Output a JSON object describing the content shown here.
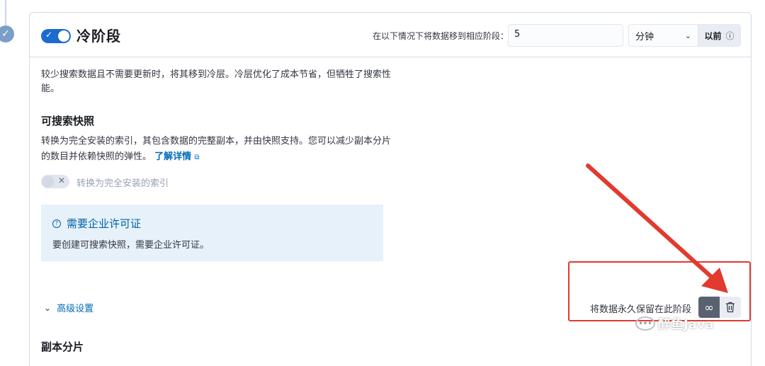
{
  "phase": {
    "title": "冷阶段",
    "enabled": true,
    "move_label": "在以下情况下将数据移到相应阶段：",
    "age_value": "5",
    "unit_selected": "分钟",
    "unit_suffix": "以前",
    "description": "较少搜索数据且不需要更新时，将其移到冷层。冷层优化了成本节省，但牺牲了搜索性能。"
  },
  "searchable_snapshot": {
    "title": "可搜索快照",
    "description": "转换为完全安装的索引，其包含数据的完整副本，并由快照支持。您可以减少副本分片的数目并依赖快照的弹性。",
    "learn_more": "了解详情",
    "toggle_label": "转换为完全安装的索引",
    "toggle_enabled": false
  },
  "callout": {
    "title": "需要企业许可证",
    "body": "要创建可搜索快照，需要企业许可证。"
  },
  "advanced": {
    "label": "高级设置"
  },
  "retention": {
    "label": "将数据永久保留在此阶段"
  },
  "replicas": {
    "title": "副本分片"
  },
  "watermark": {
    "text": "醉鱼Java"
  },
  "colors": {
    "primary": "#1b6bd0",
    "link": "#006bb8",
    "callout_bg": "#e6f1fa",
    "annotation_red": "#e23a2e"
  },
  "icons": [
    "check-icon",
    "chevron-down-icon",
    "info-icon",
    "external-link-icon",
    "question-circle-icon",
    "infinity-icon",
    "trash-icon",
    "wechat-icon"
  ]
}
